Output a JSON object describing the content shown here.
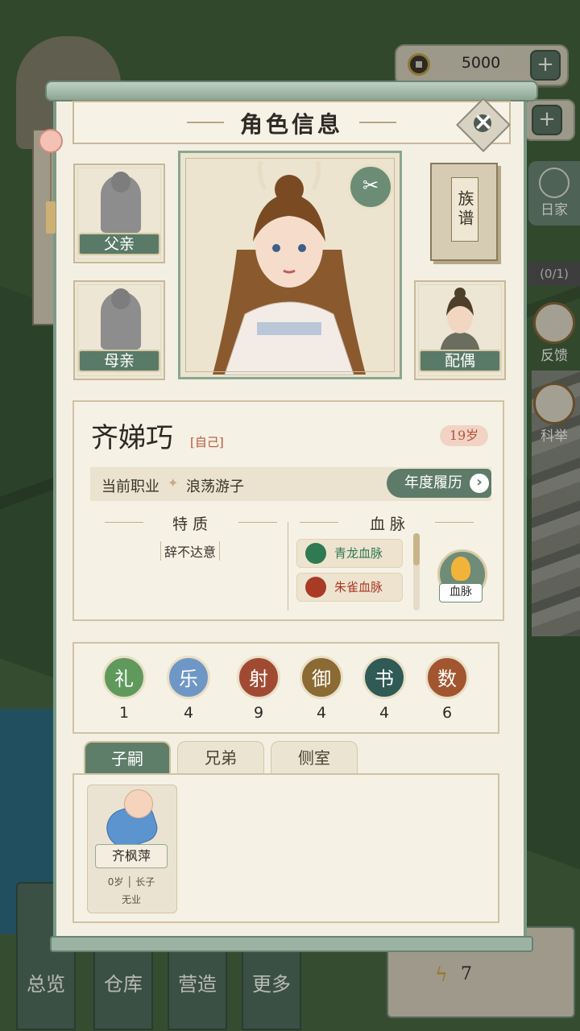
{
  "hud": {
    "coins": "5000",
    "plus": "+",
    "side": {
      "home_label": "日家",
      "quest_progress": "(0/1)",
      "feedback_label": "反馈",
      "exam_label": "科举"
    },
    "energy": "7"
  },
  "bottom_nav": [
    "总览",
    "仓库",
    "营造",
    "更多"
  ],
  "panel": {
    "title": "角色信息",
    "close": "×",
    "father_label": "父亲",
    "mother_label": "母亲",
    "spouse_label": "配偶",
    "genealogy_label": "族谱",
    "scissor": "✂"
  },
  "character": {
    "name": "齐娣巧",
    "self_tag": "[自己]",
    "age": "19岁",
    "job_label": "当前职业",
    "job_value": "浪荡游子",
    "history_button": "年度履历",
    "history_arrow": "›",
    "traits_title": "特质",
    "traits": [
      "辞不达意"
    ],
    "bloodline_title": "血脉",
    "bloodlines": [
      {
        "name": "青龙血脉",
        "color": "#2f7a52",
        "text_color": "#2f7a52"
      },
      {
        "name": "朱雀血脉",
        "color": "#a93a26",
        "text_color": "#a93a26"
      }
    ],
    "bloodline_button": "血脉"
  },
  "six_arts": [
    {
      "name": "礼",
      "value": "1",
      "color": "#5f9a5c"
    },
    {
      "name": "乐",
      "value": "4",
      "color": "#6f97c6"
    },
    {
      "name": "射",
      "value": "9",
      "color": "#a14a33"
    },
    {
      "name": "御",
      "value": "4",
      "color": "#8b6a33"
    },
    {
      "name": "书",
      "value": "4",
      "color": "#2f5a55"
    },
    {
      "name": "数",
      "value": "6",
      "color": "#a2562f"
    }
  ],
  "tabs": [
    "子嗣",
    "兄弟",
    "侧室"
  ],
  "children": [
    {
      "name": "齐枫萍",
      "age": "0岁",
      "rank": "长子",
      "job": "无业"
    }
  ]
}
